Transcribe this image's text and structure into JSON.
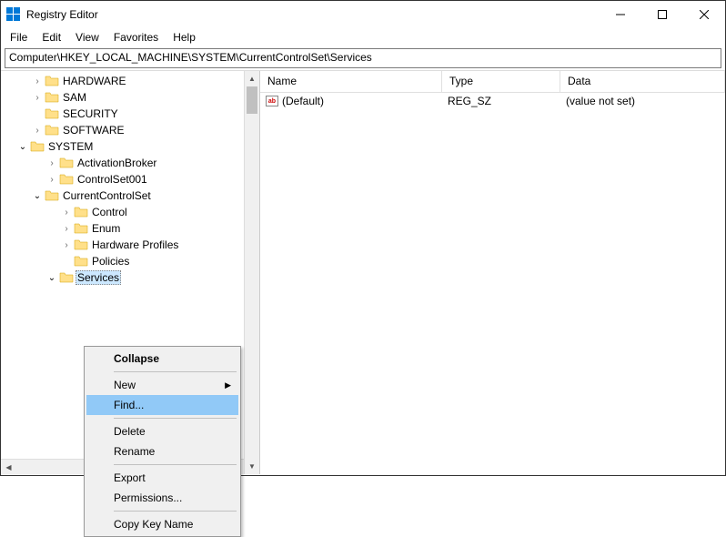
{
  "window": {
    "title": "Registry Editor"
  },
  "menubar": [
    "File",
    "Edit",
    "View",
    "Favorites",
    "Help"
  ],
  "addressbar": "Computer\\HKEY_LOCAL_MACHINE\\SYSTEM\\CurrentControlSet\\Services",
  "tree": [
    {
      "indent": 32,
      "exp": "closed",
      "label": "HARDWARE",
      "sel": false
    },
    {
      "indent": 32,
      "exp": "closed",
      "label": "SAM",
      "sel": false
    },
    {
      "indent": 32,
      "exp": "",
      "label": "SECURITY",
      "sel": false
    },
    {
      "indent": 32,
      "exp": "closed",
      "label": "SOFTWARE",
      "sel": false
    },
    {
      "indent": 16,
      "exp": "open",
      "label": "SYSTEM",
      "sel": false
    },
    {
      "indent": 48,
      "exp": "closed",
      "label": "ActivationBroker",
      "sel": false
    },
    {
      "indent": 48,
      "exp": "closed",
      "label": "ControlSet001",
      "sel": false
    },
    {
      "indent": 32,
      "exp": "open",
      "label": "CurrentControlSet",
      "sel": false
    },
    {
      "indent": 64,
      "exp": "closed",
      "label": "Control",
      "sel": false
    },
    {
      "indent": 64,
      "exp": "closed",
      "label": "Enum",
      "sel": false
    },
    {
      "indent": 64,
      "exp": "closed",
      "label": "Hardware Profiles",
      "sel": false
    },
    {
      "indent": 64,
      "exp": "",
      "label": "Policies",
      "sel": false
    },
    {
      "indent": 48,
      "exp": "open",
      "label": "Services",
      "sel": true
    }
  ],
  "list": {
    "headers": {
      "name": "Name",
      "type": "Type",
      "data": "Data"
    },
    "rows": [
      {
        "name": "(Default)",
        "type": "REG_SZ",
        "data": "(value not set)"
      }
    ]
  },
  "context_menu": [
    {
      "label": "Collapse",
      "bold": true
    },
    {
      "sep": true
    },
    {
      "label": "New",
      "submenu": true
    },
    {
      "label": "Find...",
      "hover": true
    },
    {
      "sep": true
    },
    {
      "label": "Delete"
    },
    {
      "label": "Rename"
    },
    {
      "sep": true
    },
    {
      "label": "Export"
    },
    {
      "label": "Permissions..."
    },
    {
      "sep": true
    },
    {
      "label": "Copy Key Name"
    }
  ]
}
